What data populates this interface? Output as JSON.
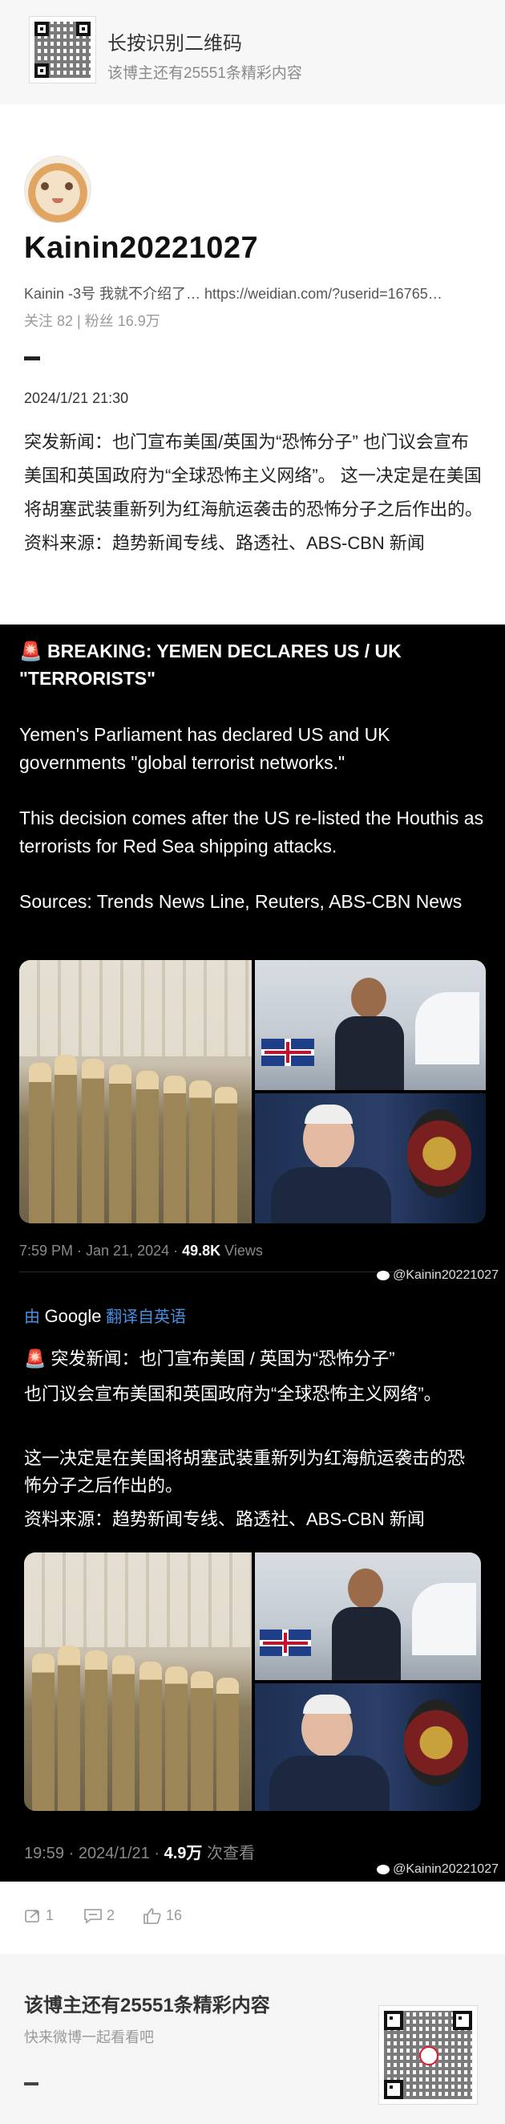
{
  "top_banner": {
    "title": "长按识别二维码",
    "subtitle": "该博主还有25551条精彩内容"
  },
  "profile": {
    "name": "Kainin20221027",
    "bio": "Kainin -3号  我就不介绍了…  https://weidian.com/?userid=16765…",
    "stats": "关注 82 | 粉丝 16.9万"
  },
  "post": {
    "timestamp": "2024/1/21 21:30",
    "text": "突发新闻：也门宣布美国/英国为“恐怖分子” 也门议会宣布美国和英国政府为“全球恐怖主义网络”。 这一决定是在美国将胡塞武装重新列为红海航运袭击的恐怖分子之后作出的。 资料来源：趋势新闻专线、路透社、ABS-CBN 新闻"
  },
  "tweet_en": {
    "alarm_icon": "🚨",
    "headline": "BREAKING: YEMEN DECLARES US / UK \"TERRORISTS\"",
    "para1": "Yemen's Parliament has declared US and UK governments  \"global terrorist networks.\"",
    "para2": "This decision comes after the US re-listed the Houthis  as terrorists for Red Sea shipping attacks.",
    "para3": "Sources: Trends News Line, Reuters, ABS-CBN News",
    "meta_time": "7:59 PM · Jan 21, 2024 · ",
    "meta_views_num": "49.8K",
    "meta_views_label": " Views",
    "watermark": "@Kainin20221027"
  },
  "translate": {
    "by": "由",
    "google": "Google",
    "label": "翻译自英语"
  },
  "tweet_cn": {
    "alarm_icon": "🚨",
    "line1": "突发新闻：也门宣布美国 / 英国为“恐怖分子”",
    "line2": "也门议会宣布美国和英国政府为“全球恐怖主义网络”。",
    "line3": "这一决定是在美国将胡塞武装重新列为红海航运袭击的恐怖分子之后作出的。",
    "line4": "资料来源：趋势新闻专线、路透社、ABS-CBN 新闻",
    "meta_time": "19:59 · 2024/1/21 · ",
    "meta_views_num": "4.9万",
    "meta_views_label": " 次查看",
    "watermark": "@Kainin20221027"
  },
  "actions": {
    "repost_count": "1",
    "comment_count": "2",
    "like_count": "16"
  },
  "footer": {
    "title": "该博主还有25551条精彩内容",
    "subtitle": "快来微博一起看看吧"
  },
  "colors": {
    "translate_blue": "#4a90e2",
    "alarm_red": "#e0322f",
    "muted_gray": "#8a8a8a"
  }
}
